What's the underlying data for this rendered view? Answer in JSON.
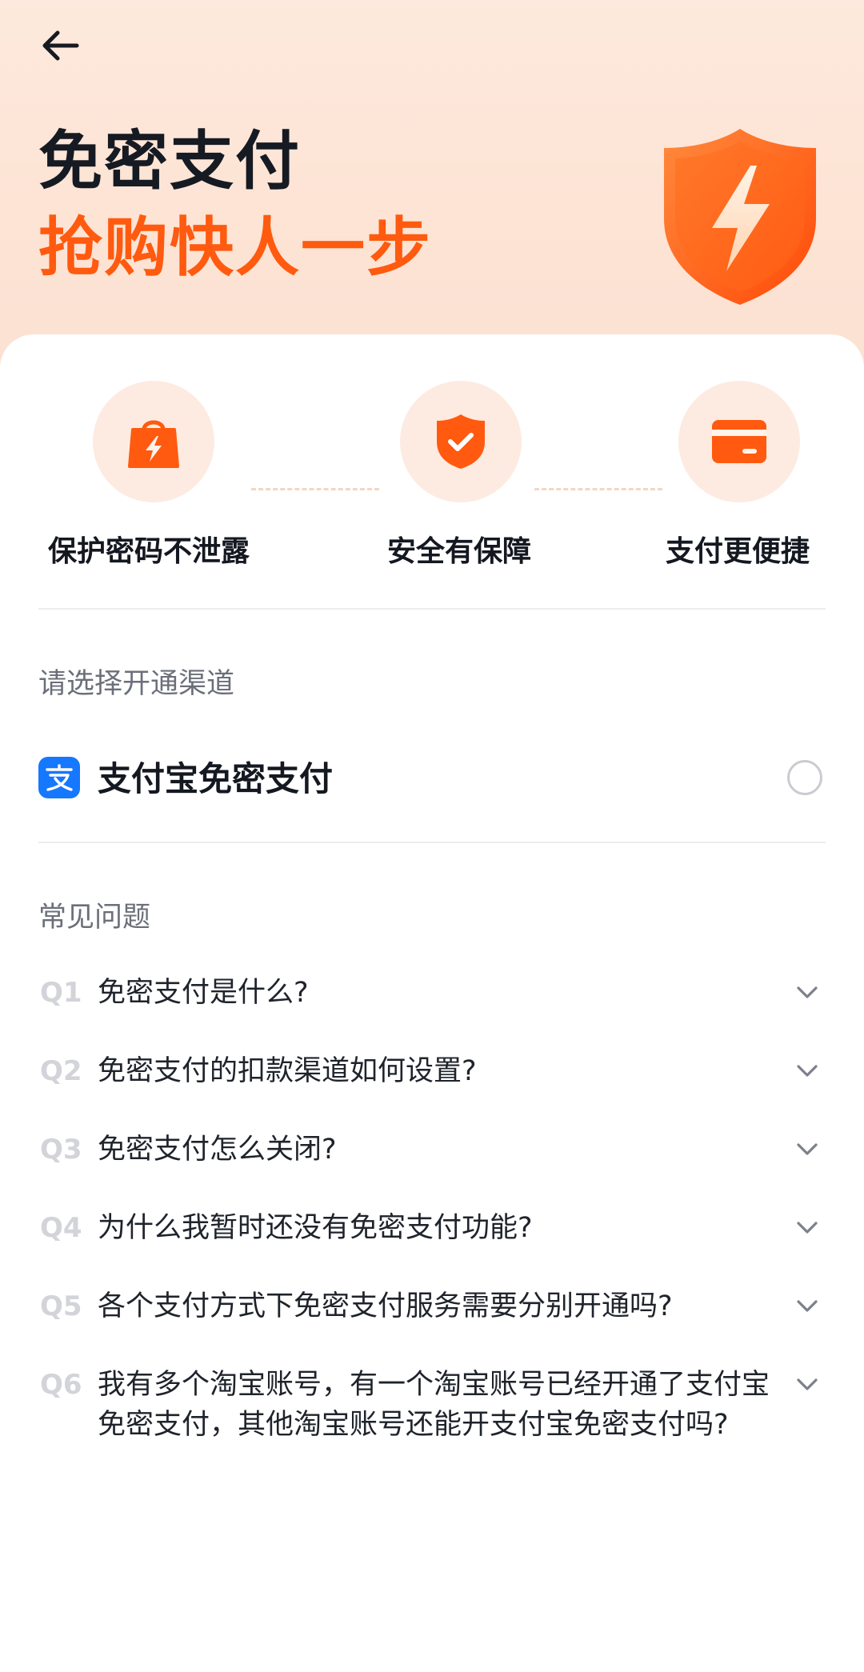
{
  "header": {
    "back_icon": "back-arrow-icon",
    "title": "免密支付",
    "subtitle": "抢购快人一步",
    "shield_icon": "lightning-shield-icon"
  },
  "features": [
    {
      "label": "保护密码不泄露",
      "icon": "shopping-bag-lightning-icon"
    },
    {
      "label": "安全有保障",
      "icon": "shield-check-icon"
    },
    {
      "label": "支付更便捷",
      "icon": "card-icon"
    }
  ],
  "channel": {
    "section_label": "请选择开通渠道",
    "option_label": "支付宝免密支付",
    "option_icon": "alipay-icon",
    "selected": false
  },
  "faq": {
    "section_label": "常见问题",
    "items": [
      {
        "num": "Q1",
        "question": "免密支付是什么?"
      },
      {
        "num": "Q2",
        "question": "免密支付的扣款渠道如何设置?"
      },
      {
        "num": "Q3",
        "question": "免密支付怎么关闭?"
      },
      {
        "num": "Q4",
        "question": "为什么我暂时还没有免密支付功能?"
      },
      {
        "num": "Q5",
        "question": "各个支付方式下免密支付服务需要分别开通吗?"
      },
      {
        "num": "Q6",
        "question": "我有多个淘宝账号，有一个淘宝账号已经开通了支付宝免密支付，其他淘宝账号还能开支付宝免密支付吗?"
      }
    ]
  },
  "colors": {
    "accent": "#ff5a0f",
    "hero_bg": "#fde6d8",
    "alipay_blue": "#1677ff"
  }
}
